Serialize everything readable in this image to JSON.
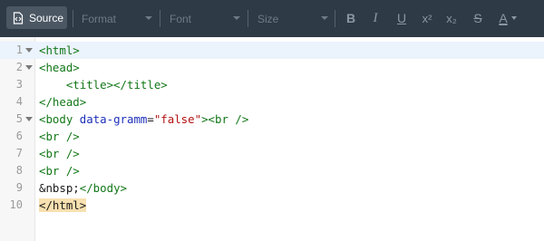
{
  "toolbar": {
    "source_label": "Source",
    "format_label": "Format",
    "font_label": "Font",
    "size_label": "Size",
    "tools": [
      {
        "name": "bold-icon",
        "glyph": "B"
      },
      {
        "name": "italic-icon",
        "glyph": "I"
      },
      {
        "name": "underline-icon",
        "glyph": "U"
      },
      {
        "name": "superscript-icon",
        "glyph": "x²"
      },
      {
        "name": "subscript-icon",
        "glyph": "x₂"
      },
      {
        "name": "strikethrough-icon",
        "glyph": "S"
      },
      {
        "name": "text-color-icon",
        "glyph": "A"
      }
    ]
  },
  "editor": {
    "line_numbers": [
      "1",
      "2",
      "3",
      "4",
      "5",
      "6",
      "7",
      "8",
      "9",
      "10"
    ],
    "lines": [
      [
        {
          "t": "tag",
          "v": "<html>"
        }
      ],
      [
        {
          "t": "tag",
          "v": "<head>"
        }
      ],
      [
        {
          "t": "plain",
          "v": "    "
        },
        {
          "t": "tag",
          "v": "<title></title>"
        }
      ],
      [
        {
          "t": "tag",
          "v": "</head>"
        }
      ],
      [
        {
          "t": "tag",
          "v": "<body "
        },
        {
          "t": "attr",
          "v": "data-gramm"
        },
        {
          "t": "plain",
          "v": "="
        },
        {
          "t": "str",
          "v": "\"false\""
        },
        {
          "t": "tag",
          "v": "><br />"
        }
      ],
      [
        {
          "t": "tag",
          "v": "<br />"
        }
      ],
      [
        {
          "t": "tag",
          "v": "<br />"
        }
      ],
      [
        {
          "t": "tag",
          "v": "<br />"
        }
      ],
      [
        {
          "t": "ent",
          "v": "&nbsp;"
        },
        {
          "t": "tag",
          "v": "</body>"
        }
      ],
      [
        {
          "t": "match",
          "v": "</html>"
        }
      ]
    ]
  },
  "colors": {
    "toolbar_bg": "#2e3a46",
    "tag": "#127718",
    "attribute": "#1d2fb8",
    "string": "#b31212",
    "active_line": "#ebf3fc",
    "bracket_match": "#f8e0b0"
  }
}
